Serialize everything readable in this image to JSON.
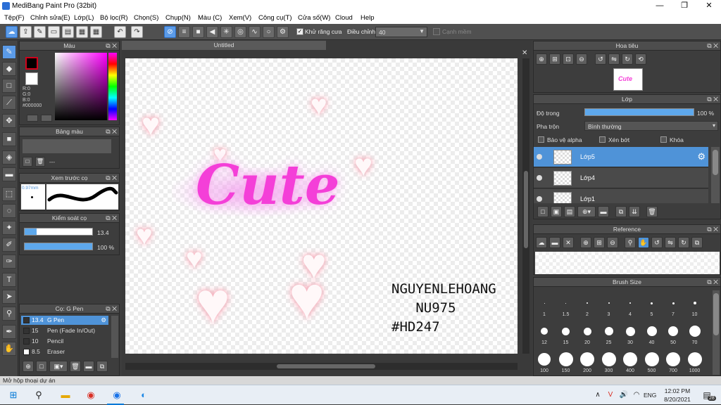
{
  "title": "MediBang Paint Pro (32bit)",
  "window_controls": [
    "—",
    "❐",
    "✕"
  ],
  "menu": [
    "Tệp(F)",
    "Chỉnh sửa(E)",
    "Lớp(L)",
    "Bộ lọc(R)",
    "Chọn(S)",
    "Chụp(N)",
    "Màu (C)",
    "Xem(V)",
    "Công cụ(T)",
    "Cửa số(W)",
    "Cloud",
    "Help"
  ],
  "toolbar": {
    "antialias_label": "Khử răng cưa",
    "adjust_label": "Điều chỉnh",
    "adjust_value": "40",
    "snap_label": "Cạnh mềm"
  },
  "color_panel": {
    "title": "Màu",
    "r": "R:0",
    "g": "G:0",
    "b": "B:0",
    "hex": "#000000",
    "fg": "#000000",
    "bg": "#ffffff",
    "accent": "#d0021b"
  },
  "palette_panel": {
    "title": "Bảng màu",
    "placeholder": "---"
  },
  "brush_preview_panel": {
    "title": "Xem trước cọ",
    "size": "0.97mm"
  },
  "brush_control_panel": {
    "title": "Kiểm soát cọ",
    "size_value": "13.4",
    "opacity_value": "100 %"
  },
  "brush_list_panel": {
    "title": "Cọ: G Pen",
    "items": [
      {
        "size": "13.4",
        "name": "G Pen"
      },
      {
        "size": "15",
        "name": "Pen (Fade In/Out)"
      },
      {
        "size": "10",
        "name": "Pencil"
      },
      {
        "size": "8.5",
        "name": "Eraser"
      }
    ]
  },
  "canvas": {
    "tab": "Untitled",
    "main_text": "Cute",
    "signature": "NGUYENLEHOANG\n   NU975\n#HD247"
  },
  "navigator_panel": {
    "title": "Hoa tiêu"
  },
  "layer_panel": {
    "title": "Lớp",
    "opacity_label": "Độ trong",
    "opacity_value": "100 %",
    "blend_label": "Pha trộn",
    "blend_value": "Bình thường",
    "protect_alpha": "Bảo vệ alpha",
    "clipping": "Xén bớt",
    "lock": "Khóa",
    "layers": [
      "Lớp5",
      "Lớp4",
      "Lớp1"
    ]
  },
  "reference_panel": {
    "title": "Reference"
  },
  "brush_size_panel": {
    "title": "Brush Size",
    "sizes": [
      "1",
      "1.5",
      "2",
      "3",
      "4",
      "5",
      "7",
      "10",
      "12",
      "15",
      "20",
      "25",
      "30",
      "40",
      "50",
      "70",
      "100",
      "150",
      "200",
      "300",
      "400",
      "500",
      "700",
      "1000"
    ]
  },
  "status": "Mở hộp thoại dự án",
  "taskbar": {
    "time": "12:02 PM",
    "date": "8/20/2021",
    "lang": "ENG",
    "notif": "28"
  }
}
